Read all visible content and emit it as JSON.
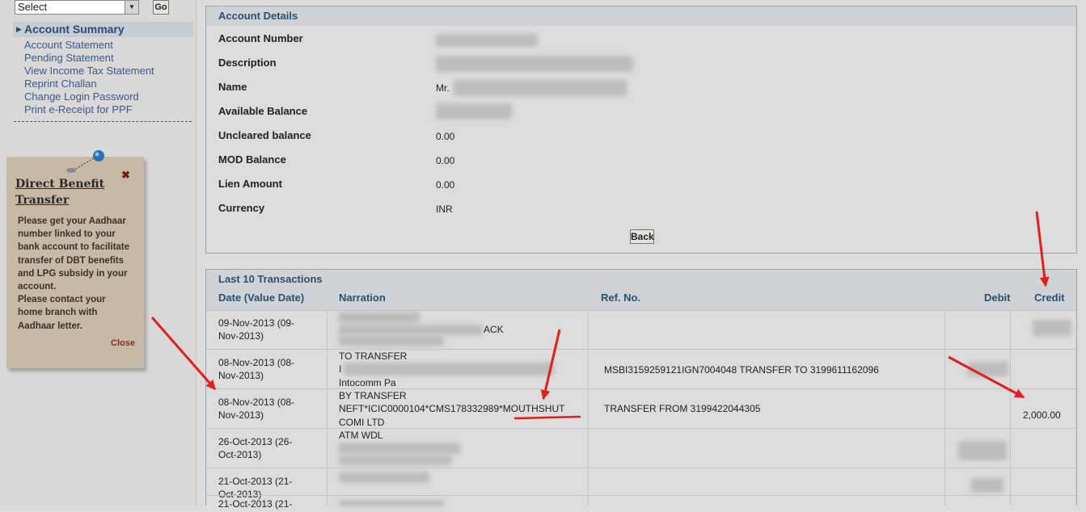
{
  "sidebar": {
    "select_value": "Select",
    "go_label": "Go",
    "active_item": "Account Summary",
    "items": [
      "Account Statement",
      "Pending Statement",
      "View Income Tax Statement",
      "Reprint Challan",
      "Change Login Password",
      "Print e-Receipt for PPF"
    ]
  },
  "dbt": {
    "title_line1": "Direct Benefit",
    "title_line2": "Transfer",
    "body": [
      "Please get your Aadhaar",
      "number linked to your",
      "bank account to facilitate",
      "transfer of DBT benefits",
      "and LPG subsidy in your",
      "account.",
      "Please contact your",
      "home branch with",
      "Aadhaar letter."
    ],
    "close_label": "Close"
  },
  "account": {
    "title": "Account Details",
    "rows": [
      {
        "label": "Account Number",
        "value": ""
      },
      {
        "label": "Description",
        "value": ""
      },
      {
        "label": "Name",
        "value": "Mr."
      },
      {
        "label": "Available Balance",
        "value": ""
      },
      {
        "label": "Uncleared balance",
        "value": "0.00"
      },
      {
        "label": "MOD Balance",
        "value": "0.00"
      },
      {
        "label": "Lien Amount",
        "value": "0.00"
      },
      {
        "label": "Currency",
        "value": "INR"
      }
    ],
    "back_label": "Back"
  },
  "transactions": {
    "title": "Last 10 Transactions",
    "headers": {
      "date": "Date (Value Date)",
      "narration": "Narration",
      "ref": "Ref. No.",
      "debit": "Debit",
      "credit": "Credit"
    },
    "rows": [
      {
        "date1": "09-Nov-2013 (09-",
        "date2": "Nov-2013)",
        "narr": [
          "",
          "ACK",
          ""
        ],
        "ref": "",
        "debit": "",
        "credit": ""
      },
      {
        "date1": "08-Nov-2013 (08-",
        "date2": "Nov-2013)",
        "narr": [
          "TO TRANSFER",
          "I",
          "Intocomm Pa"
        ],
        "ref": "MSBI3159259121IGN7004048 TRANSFER TO 3199611162096",
        "debit": "",
        "credit": ""
      },
      {
        "date1": "08-Nov-2013 (08-",
        "date2": "Nov-2013)",
        "narr": [
          "BY TRANSFER",
          "NEFT*ICIC0000104*CMS178332989*MOUTHSHUT",
          "COMI LTD"
        ],
        "ref": "TRANSFER FROM 3199422044305",
        "debit": "",
        "credit": "2,000.00"
      },
      {
        "date1": "26-Oct-2013 (26-",
        "date2": "Oct-2013)",
        "narr": [
          "ATM WDL",
          "",
          ""
        ],
        "ref": "",
        "debit": "",
        "credit": ""
      },
      {
        "date1": "21-Oct-2013 (21-",
        "date2": "Oct-2013)",
        "narr": [
          "",
          "",
          ""
        ],
        "ref": "",
        "debit": "",
        "credit": ""
      },
      {
        "date1": "21-Oct-2013 (21-",
        "date2": "",
        "narr": [
          "",
          "",
          ""
        ],
        "ref": "",
        "debit": "",
        "credit": ""
      }
    ]
  },
  "annotation_color": "#e0201a"
}
